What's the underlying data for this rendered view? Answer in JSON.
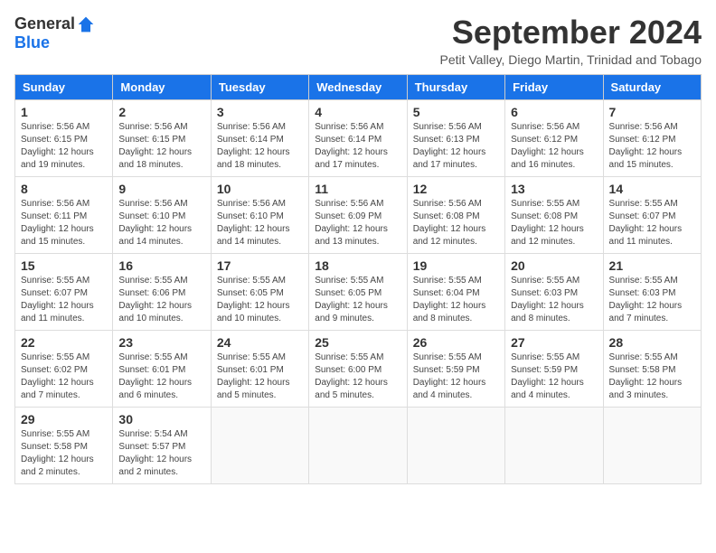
{
  "logo": {
    "general": "General",
    "blue": "Blue"
  },
  "title": "September 2024",
  "subtitle": "Petit Valley, Diego Martin, Trinidad and Tobago",
  "weekdays": [
    "Sunday",
    "Monday",
    "Tuesday",
    "Wednesday",
    "Thursday",
    "Friday",
    "Saturday"
  ],
  "days": [
    {
      "day": "",
      "info": ""
    },
    {
      "day": "1",
      "info": "Sunrise: 5:56 AM\nSunset: 6:15 PM\nDaylight: 12 hours and 19 minutes."
    },
    {
      "day": "2",
      "info": "Sunrise: 5:56 AM\nSunset: 6:15 PM\nDaylight: 12 hours and 18 minutes."
    },
    {
      "day": "3",
      "info": "Sunrise: 5:56 AM\nSunset: 6:14 PM\nDaylight: 12 hours and 18 minutes."
    },
    {
      "day": "4",
      "info": "Sunrise: 5:56 AM\nSunset: 6:14 PM\nDaylight: 12 hours and 17 minutes."
    },
    {
      "day": "5",
      "info": "Sunrise: 5:56 AM\nSunset: 6:13 PM\nDaylight: 12 hours and 17 minutes."
    },
    {
      "day": "6",
      "info": "Sunrise: 5:56 AM\nSunset: 6:12 PM\nDaylight: 12 hours and 16 minutes."
    },
    {
      "day": "7",
      "info": "Sunrise: 5:56 AM\nSunset: 6:12 PM\nDaylight: 12 hours and 15 minutes."
    },
    {
      "day": "8",
      "info": "Sunrise: 5:56 AM\nSunset: 6:11 PM\nDaylight: 12 hours and 15 minutes."
    },
    {
      "day": "9",
      "info": "Sunrise: 5:56 AM\nSunset: 6:10 PM\nDaylight: 12 hours and 14 minutes."
    },
    {
      "day": "10",
      "info": "Sunrise: 5:56 AM\nSunset: 6:10 PM\nDaylight: 12 hours and 14 minutes."
    },
    {
      "day": "11",
      "info": "Sunrise: 5:56 AM\nSunset: 6:09 PM\nDaylight: 12 hours and 13 minutes."
    },
    {
      "day": "12",
      "info": "Sunrise: 5:56 AM\nSunset: 6:08 PM\nDaylight: 12 hours and 12 minutes."
    },
    {
      "day": "13",
      "info": "Sunrise: 5:55 AM\nSunset: 6:08 PM\nDaylight: 12 hours and 12 minutes."
    },
    {
      "day": "14",
      "info": "Sunrise: 5:55 AM\nSunset: 6:07 PM\nDaylight: 12 hours and 11 minutes."
    },
    {
      "day": "15",
      "info": "Sunrise: 5:55 AM\nSunset: 6:07 PM\nDaylight: 12 hours and 11 minutes."
    },
    {
      "day": "16",
      "info": "Sunrise: 5:55 AM\nSunset: 6:06 PM\nDaylight: 12 hours and 10 minutes."
    },
    {
      "day": "17",
      "info": "Sunrise: 5:55 AM\nSunset: 6:05 PM\nDaylight: 12 hours and 10 minutes."
    },
    {
      "day": "18",
      "info": "Sunrise: 5:55 AM\nSunset: 6:05 PM\nDaylight: 12 hours and 9 minutes."
    },
    {
      "day": "19",
      "info": "Sunrise: 5:55 AM\nSunset: 6:04 PM\nDaylight: 12 hours and 8 minutes."
    },
    {
      "day": "20",
      "info": "Sunrise: 5:55 AM\nSunset: 6:03 PM\nDaylight: 12 hours and 8 minutes."
    },
    {
      "day": "21",
      "info": "Sunrise: 5:55 AM\nSunset: 6:03 PM\nDaylight: 12 hours and 7 minutes."
    },
    {
      "day": "22",
      "info": "Sunrise: 5:55 AM\nSunset: 6:02 PM\nDaylight: 12 hours and 7 minutes."
    },
    {
      "day": "23",
      "info": "Sunrise: 5:55 AM\nSunset: 6:01 PM\nDaylight: 12 hours and 6 minutes."
    },
    {
      "day": "24",
      "info": "Sunrise: 5:55 AM\nSunset: 6:01 PM\nDaylight: 12 hours and 5 minutes."
    },
    {
      "day": "25",
      "info": "Sunrise: 5:55 AM\nSunset: 6:00 PM\nDaylight: 12 hours and 5 minutes."
    },
    {
      "day": "26",
      "info": "Sunrise: 5:55 AM\nSunset: 5:59 PM\nDaylight: 12 hours and 4 minutes."
    },
    {
      "day": "27",
      "info": "Sunrise: 5:55 AM\nSunset: 5:59 PM\nDaylight: 12 hours and 4 minutes."
    },
    {
      "day": "28",
      "info": "Sunrise: 5:55 AM\nSunset: 5:58 PM\nDaylight: 12 hours and 3 minutes."
    },
    {
      "day": "29",
      "info": "Sunrise: 5:55 AM\nSunset: 5:58 PM\nDaylight: 12 hours and 2 minutes."
    },
    {
      "day": "30",
      "info": "Sunrise: 5:54 AM\nSunset: 5:57 PM\nDaylight: 12 hours and 2 minutes."
    }
  ]
}
